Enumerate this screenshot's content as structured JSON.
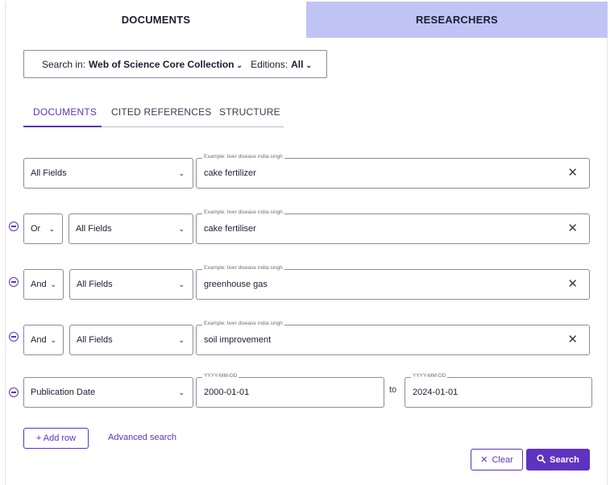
{
  "top_tabs": {
    "documents": "DOCUMENTS",
    "researchers": "RESEARCHERS"
  },
  "search_in": {
    "label": "Search in:",
    "collection": "Web of Science Core Collection",
    "editions_label": "Editions:",
    "editions_value": "All"
  },
  "sub_tabs": {
    "documents": "DOCUMENTS",
    "cited_references": "CITED REFERENCES",
    "structure": "STRUCTURE"
  },
  "rows": [
    {
      "field": "All Fields",
      "placeholder": "Example: liver disease india singh",
      "value": "cake fertilizer"
    },
    {
      "operator": "Or",
      "field": "All Fields",
      "placeholder": "Example: liver disease india singh",
      "value": "cake fertiliser"
    },
    {
      "operator": "And",
      "field": "All Fields",
      "placeholder": "Example: liver disease india singh",
      "value": "greenhouse gas"
    },
    {
      "operator": "And",
      "field": "All Fields",
      "placeholder": "Example: liver disease india singh",
      "value": "soil improvement"
    }
  ],
  "date_row": {
    "field": "Publication Date",
    "from_placeholder": "YYYY-MM-DD",
    "from_value": "2000-01-01",
    "to_label": "to",
    "to_placeholder": "YYYY-MM-DD",
    "to_value": "2024-01-01"
  },
  "actions": {
    "add_row": "+ Add row",
    "advanced_search": "Advanced search",
    "clear": "Clear",
    "search": "Search"
  },
  "icons": {
    "clear_icon": "✕",
    "search_icon": "magnifier",
    "remove_row_icon": "minus-circle",
    "chevron": "chevron-down"
  },
  "colors": {
    "accent": "#5e33bf",
    "researchers_tab_bg": "#c0c4f5",
    "border": "#8a8c9c"
  }
}
